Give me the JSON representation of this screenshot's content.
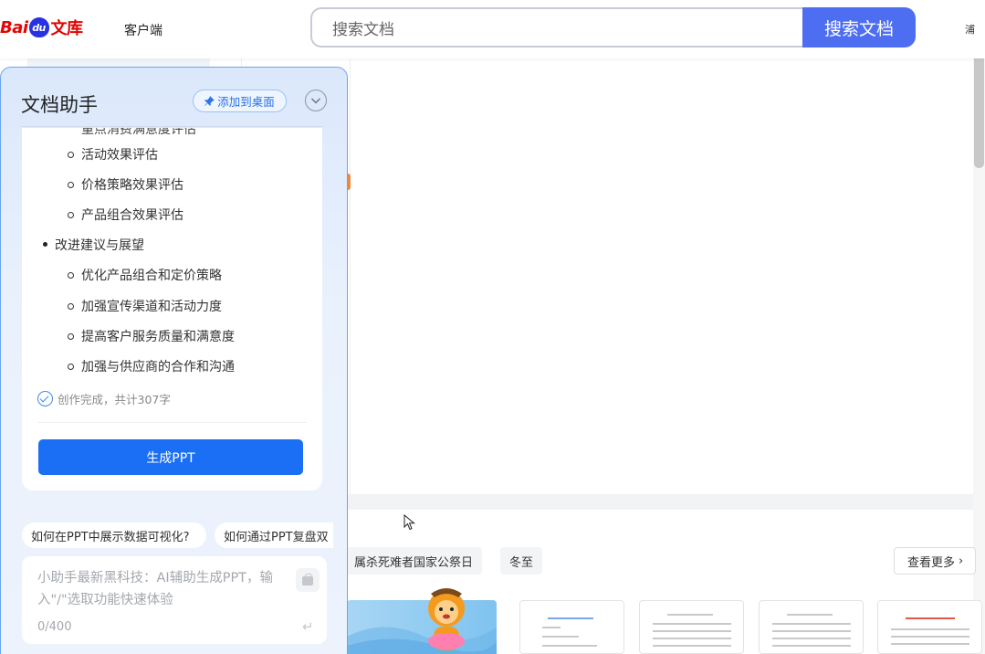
{
  "header": {
    "logo": {
      "bai": "Bai",
      "du": "du",
      "wenku": "文库"
    },
    "client_label": "客户端",
    "search_placeholder": "搜索文档",
    "search_button": "搜索文档",
    "edge_text": "浦"
  },
  "background": {
    "tags": [
      "属杀死难者国家公祭日",
      "冬至"
    ],
    "see_more": "查看更多",
    "see_more_arrow": "›"
  },
  "assistant": {
    "title": "文档助手",
    "pin_label": "添加到桌面",
    "clipped_line": "重点消费满意度评估",
    "outline": [
      {
        "level": "sub",
        "text": "活动效果评估"
      },
      {
        "level": "sub",
        "text": "价格策略效果评估"
      },
      {
        "level": "sub",
        "text": "产品组合效果评估"
      },
      {
        "level": "top",
        "text": "改进建议与展望"
      },
      {
        "level": "sub",
        "text": "优化产品组合和定价策略"
      },
      {
        "level": "sub",
        "text": "加强宣传渠道和活动力度"
      },
      {
        "level": "sub",
        "text": "提高客户服务质量和满意度"
      },
      {
        "level": "sub",
        "text": "加强与供应商的合作和沟通"
      }
    ],
    "status": "创作完成，共计307字",
    "generate_button": "生成PPT",
    "chips": [
      "如何在PPT中展示数据可视化?",
      "如何通过PPT复盘双"
    ],
    "input": {
      "placeholder": "小助手最新黑科技：AI辅助生成PPT，输入\"/\"选取功能快速体验",
      "count": "0/400"
    }
  }
}
